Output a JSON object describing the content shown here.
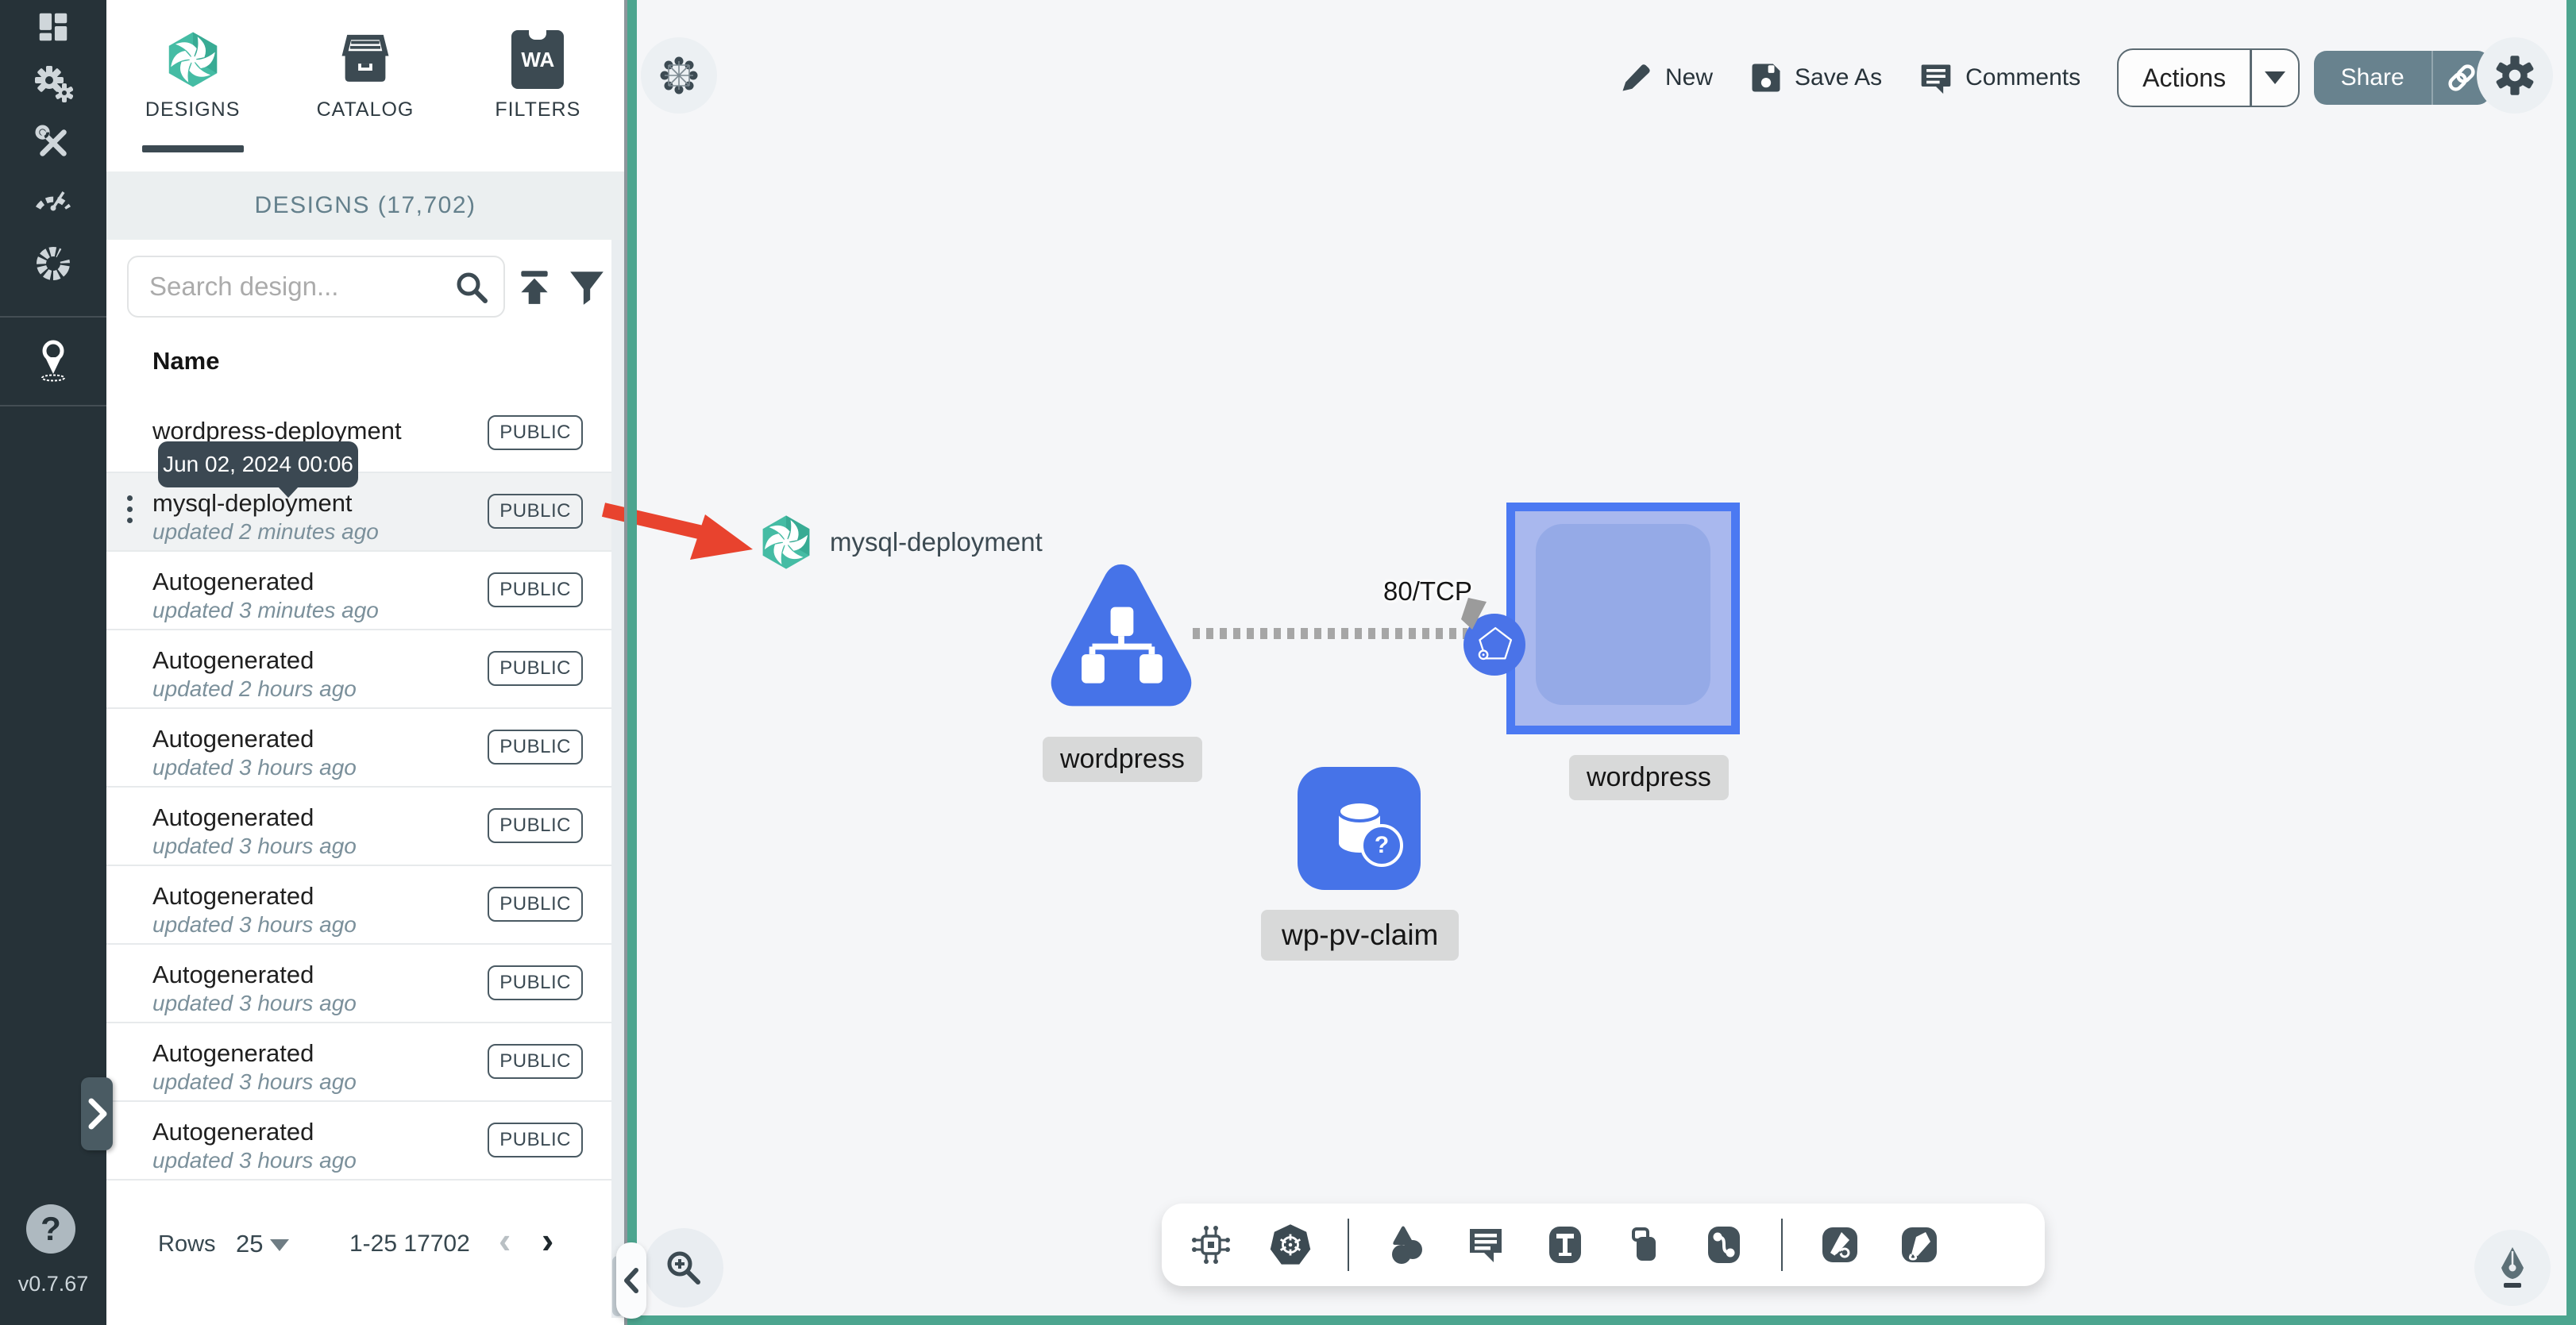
{
  "version": "v0.7.67",
  "sidebar": {
    "items": [
      "dashboard",
      "lifecycle",
      "configuration",
      "performance",
      "extensions",
      "kanvas"
    ]
  },
  "panel": {
    "tabs": [
      {
        "label": "DESIGNS"
      },
      {
        "label": "CATALOG"
      },
      {
        "label": "FILTERS",
        "badge": "WA"
      }
    ],
    "header": "DESIGNS (17,702)",
    "search_placeholder": "Search design...",
    "columns": {
      "name": "Name"
    },
    "tooltip": "Jun 02, 2024 00:06",
    "rows": [
      {
        "name": "wordpress-deployment",
        "updated": "",
        "badge": "PUBLIC",
        "selected": false
      },
      {
        "name": "mysql-deployment",
        "updated": "updated 2 minutes ago",
        "badge": "PUBLIC",
        "selected": true
      },
      {
        "name": "Autogenerated",
        "updated": "updated 3 minutes ago",
        "badge": "PUBLIC",
        "selected": false
      },
      {
        "name": "Autogenerated",
        "updated": "updated 2 hours ago",
        "badge": "PUBLIC",
        "selected": false
      },
      {
        "name": "Autogenerated",
        "updated": "updated 3 hours ago",
        "badge": "PUBLIC",
        "selected": false
      },
      {
        "name": "Autogenerated",
        "updated": "updated 3 hours ago",
        "badge": "PUBLIC",
        "selected": false
      },
      {
        "name": "Autogenerated",
        "updated": "updated 3 hours ago",
        "badge": "PUBLIC",
        "selected": false
      },
      {
        "name": "Autogenerated",
        "updated": "updated 3 hours ago",
        "badge": "PUBLIC",
        "selected": false
      },
      {
        "name": "Autogenerated",
        "updated": "updated 3 hours ago",
        "badge": "PUBLIC",
        "selected": false
      },
      {
        "name": "Autogenerated",
        "updated": "updated 3 hours ago",
        "badge": "PUBLIC",
        "selected": false
      }
    ],
    "footer": {
      "rows_label": "Rows",
      "per_page": "25",
      "range": "1-25 17702"
    }
  },
  "toolbar": {
    "new_label": "New",
    "save_as_label": "Save As",
    "comments_label": "Comments",
    "actions_label": "Actions",
    "share_label": "Share"
  },
  "canvas": {
    "mysql_node_label": "mysql-deployment",
    "wordpress_service_label": "wordpress",
    "wordpress_deployment_label": "wordpress",
    "pvc_label": "wp-pv-claim",
    "edge_label": "80/TCP"
  },
  "colors": {
    "teal_accent": "#4CA58F",
    "node_blue": "#4673E8",
    "arrow_red": "#E8432E",
    "sidebar_dark": "#263238"
  }
}
